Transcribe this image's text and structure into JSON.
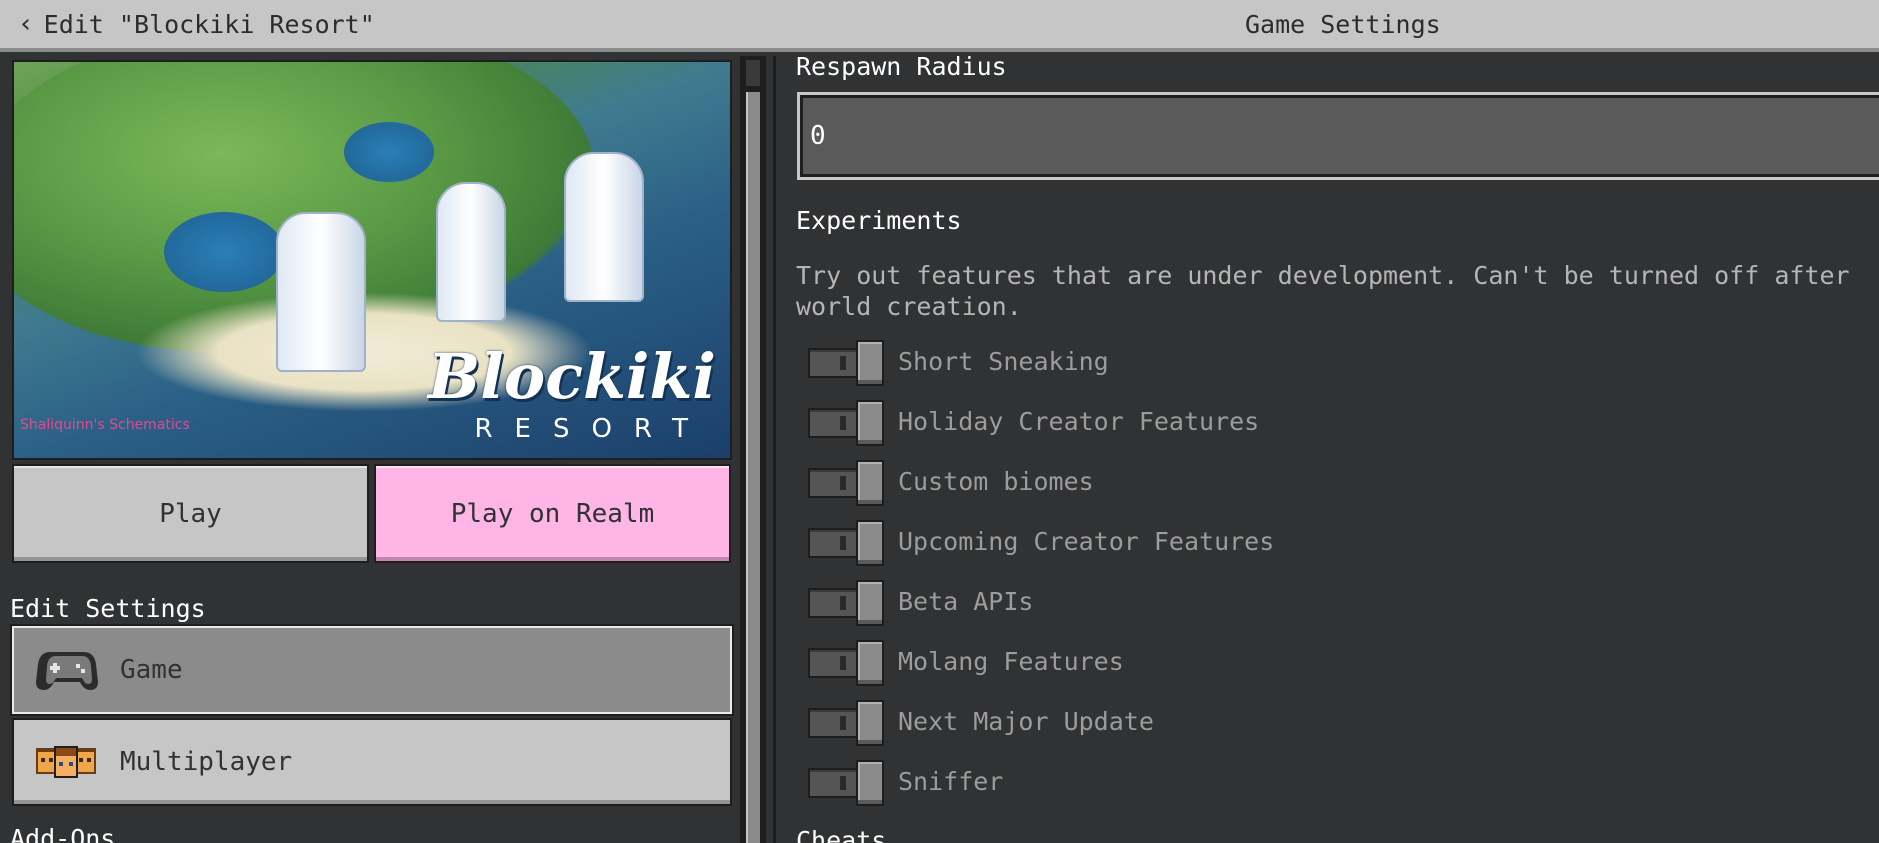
{
  "header": {
    "back_label": "Edit \"Blockiki Resort\"",
    "title": "Game Settings"
  },
  "world": {
    "logo_title": "Blockiki",
    "logo_subtitle": "RESORT",
    "logo_credit": "Shaliquinn's Schematics"
  },
  "buttons": {
    "play": "Play",
    "play_on_realm": "Play on Realm"
  },
  "edit_settings": {
    "heading": "Edit Settings",
    "items": [
      {
        "label": "Game",
        "icon": "controller-icon",
        "selected": true
      },
      {
        "label": "Multiplayer",
        "icon": "multiplayer-icon",
        "selected": false
      }
    ],
    "next_heading": "Add-Ons"
  },
  "settings": {
    "respawn_radius": {
      "label": "Respawn Radius",
      "value": "0"
    },
    "experiments": {
      "title": "Experiments",
      "description": "Try out features that are under development. Can't be turned off after world creation.",
      "toggles": [
        {
          "label": "Short Sneaking",
          "enabled": false
        },
        {
          "label": "Holiday Creator Features",
          "enabled": false
        },
        {
          "label": "Custom biomes",
          "enabled": false
        },
        {
          "label": "Upcoming Creator Features",
          "enabled": false
        },
        {
          "label": "Beta APIs",
          "enabled": false
        },
        {
          "label": "Molang Features",
          "enabled": false
        },
        {
          "label": "Next Major Update",
          "enabled": false
        },
        {
          "label": "Sniffer",
          "enabled": false
        }
      ]
    },
    "next_section": "Cheats"
  },
  "colors": {
    "background": "#313233",
    "top_bar": "#c6c6c6",
    "realm_button": "#ffb6e6",
    "selected_nav": "#8b8b8b"
  }
}
